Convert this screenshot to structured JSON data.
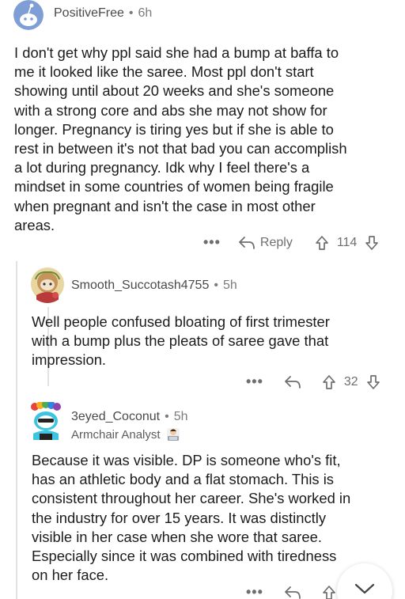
{
  "comments": [
    {
      "username": "PositiveFree",
      "age": "6h",
      "lines": [
        "I don't get why ppl said she had a bump at baffa to",
        "me it looked like the saree. Most ppl don't start",
        "showing until about 20 weeks and she's someone",
        "with a strong core and abs she may not show for",
        "longer. Pregnancy is tiring yes but if she is able to",
        "rest in between it's not that bad you can accomplish",
        "a lot during pregnancy. Idk why I feel there's a",
        "mindset in some countries of women being fragile",
        "when pregnant and isn't the case in most other",
        "areas."
      ],
      "more": "•••",
      "reply_label": "Reply",
      "score": "114"
    },
    {
      "username": "Smooth_Succotash4755",
      "age": "5h",
      "lines": [
        "Well people confused bloating of first trimester",
        "with a bump plus the pleats of saree gave that",
        "impression."
      ],
      "more": "•••",
      "score": "32"
    },
    {
      "username": "3eyed_Coconut",
      "age": "5h",
      "flair": "Armchair Analyst",
      "lines": [
        "Because it was visible. DP is someone who's fit,",
        "has an athletic body and a flat stomach. This is",
        "consistent throughout her career. She's worked in",
        "the industry for over 15 years. It was distinctly",
        "visible in her case when she wore that saree.",
        "Especially since it was combined with tiredness",
        "on her face."
      ],
      "more": "•••"
    }
  ],
  "separator": "•",
  "colors": {
    "text": "#1c1c1c",
    "meta": "#7c7c7c",
    "thread_line": "#e2e2e2",
    "avatar_blue": "#7f9ed6"
  },
  "icons": {
    "reply": "reply-arrow-icon",
    "upvote": "upvote-arrow-icon",
    "downvote": "downvote-arrow-icon",
    "collapse": "chevron-down-icon"
  }
}
